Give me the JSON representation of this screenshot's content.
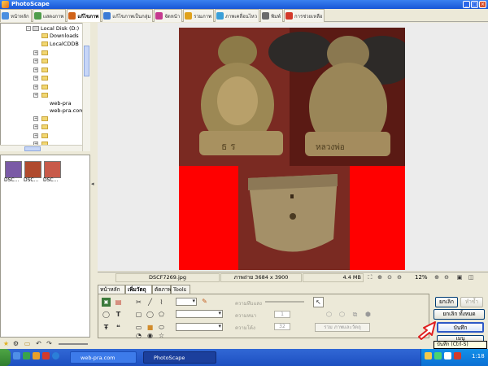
{
  "window": {
    "title": "PhotoScape"
  },
  "main_tabs": [
    {
      "label": "หน้าหลัก",
      "icon": "home-icon",
      "color": "#4a8fe0"
    },
    {
      "label": "แสดงภาพ",
      "icon": "viewer-icon",
      "color": "#4f9d4a"
    },
    {
      "label": "แก้ไขภาพ",
      "icon": "editor-icon",
      "color": "#d0631a",
      "active": true
    },
    {
      "label": "แก้ไขภาพเป็นกลุ่ม",
      "icon": "batch-editor-icon",
      "color": "#3b7bd6"
    },
    {
      "label": "จัดหน้า",
      "icon": "page-icon",
      "color": "#c53a8f"
    },
    {
      "label": "รวมภาพ",
      "icon": "combine-icon",
      "color": "#e0a21c"
    },
    {
      "label": "ภาพเคลื่อนไหว",
      "icon": "animated-gif-icon",
      "color": "#3a9fd8"
    },
    {
      "label": "พิมพ์",
      "icon": "print-icon",
      "color": "#6b6b6b"
    },
    {
      "label": "การช่วยเหลือ",
      "icon": "help-icon",
      "color": "#d33a2b"
    }
  ],
  "folder_tree": {
    "root": "Local Disk (D:)",
    "items": [
      "Downloads",
      "LocalCDDB",
      "web-pra",
      "web-pra.com"
    ]
  },
  "thumbnails": [
    {
      "label": "DSC...",
      "color": "#7a5aa6"
    },
    {
      "label": "DSC...",
      "color": "#b04a2e"
    },
    {
      "label": "DSC...",
      "color": "#c85a4a"
    }
  ],
  "status": {
    "filename": "DSCF7269.jpg",
    "dimensions": "ภาพถ่าย 3684 x 3900",
    "filesize": "4.4 MB",
    "zoom": "12%"
  },
  "editor_tabs": [
    "หน้าหลัก",
    "เพิ่มวัตถุ",
    "ตัดภาพ",
    "Tools"
  ],
  "object_panel": {
    "label_transparency": "ความทึบแสง",
    "label_thickness": "ความหนา",
    "label_roundness": "ความโค้ง",
    "thickness_value": "1",
    "roundness_value": "32",
    "merge_button": "รวม ภาพและวัตถุ"
  },
  "actions": {
    "undo": "ยกเลิก",
    "redo": "ทำซ้ำ",
    "undo_all": "ยกเลิก ทั้งหมด",
    "save": "บันทึก",
    "menu": "เมนู",
    "save_tooltip": "บันทึก (Ctrl-S)"
  },
  "taskbar": {
    "tasks": [
      "web-pra.com",
      "PhotoScape"
    ],
    "clock": "1:18"
  },
  "colors": {
    "accent": "#2e59c6",
    "highlight_arrow": "#e02020",
    "photo_background": "#ff0000"
  }
}
